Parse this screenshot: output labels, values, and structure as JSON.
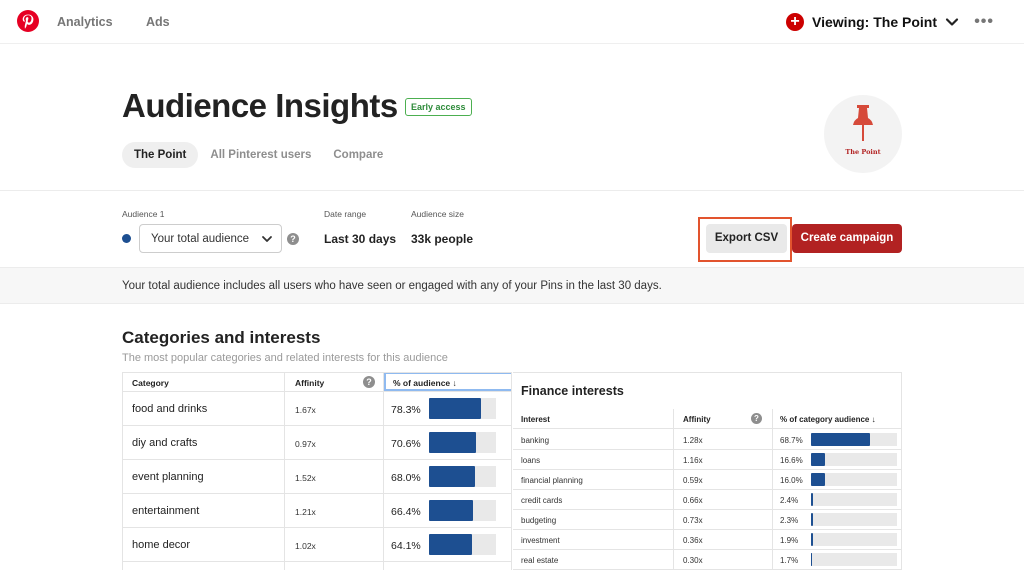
{
  "nav": {
    "links": [
      "Analytics",
      "Ads"
    ],
    "viewing": "Viewing: The Point",
    "more": "•••"
  },
  "header": {
    "title": "Audience Insights",
    "badge": "Early access",
    "tabs": [
      "The Point",
      "All Pinterest users",
      "Compare"
    ],
    "active_tab": "The Point",
    "avatar_label": "The Point"
  },
  "controls": {
    "audience_label": "Audience 1",
    "audience_value": "Your total audience",
    "date_range_label": "Date range",
    "date_range_value": "Last 30 days",
    "audience_size_label": "Audience size",
    "audience_size_value": "33k people",
    "export_button": "Export CSV",
    "create_button": "Create campaign",
    "series_color": "#1d4f91",
    "accent_color": "#b22222"
  },
  "notice": "Your total audience includes all users who have seen or engaged with any of your Pins in the last 30 days.",
  "categories": {
    "title": "Categories and interests",
    "subtitle": "The most popular categories and related interests for this audience",
    "headers": [
      "Category",
      "Affinity",
      "% of audience"
    ],
    "rows": [
      {
        "name": "food and drinks",
        "affinity": "1.67x",
        "pct": "78.3%",
        "value": 78.3
      },
      {
        "name": "diy and crafts",
        "affinity": "0.97x",
        "pct": "70.6%",
        "value": 70.6
      },
      {
        "name": "event planning",
        "affinity": "1.52x",
        "pct": "68.0%",
        "value": 68.0
      },
      {
        "name": "entertainment",
        "affinity": "1.21x",
        "pct": "66.4%",
        "value": 66.4
      },
      {
        "name": "home decor",
        "affinity": "1.02x",
        "pct": "64.1%",
        "value": 64.1
      }
    ]
  },
  "interests": {
    "title": "Finance interests",
    "headers": [
      "Interest",
      "Affinity",
      "% of category audience"
    ],
    "rows": [
      {
        "name": "banking",
        "affinity": "1.28x",
        "pct": "68.7%",
        "value": 68.7
      },
      {
        "name": "loans",
        "affinity": "1.16x",
        "pct": "16.6%",
        "value": 16.6
      },
      {
        "name": "financial planning",
        "affinity": "0.59x",
        "pct": "16.0%",
        "value": 16.0
      },
      {
        "name": "credit cards",
        "affinity": "0.66x",
        "pct": "2.4%",
        "value": 2.4
      },
      {
        "name": "budgeting",
        "affinity": "0.73x",
        "pct": "2.3%",
        "value": 2.3
      },
      {
        "name": "investment",
        "affinity": "0.36x",
        "pct": "1.9%",
        "value": 1.9
      },
      {
        "name": "real estate",
        "affinity": "0.30x",
        "pct": "1.7%",
        "value": 1.7
      }
    ]
  }
}
